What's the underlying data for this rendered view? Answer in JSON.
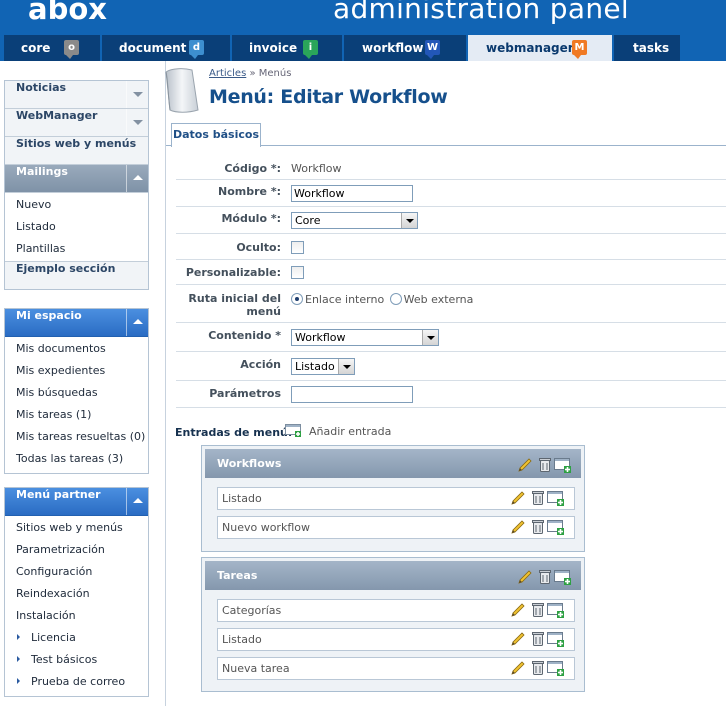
{
  "header": {
    "logo": "abox",
    "title": "administration panel"
  },
  "tabs": [
    {
      "label": "core",
      "icon": "core-icon",
      "icon_char": "o",
      "icon_color": "#8a8a8a",
      "active": false
    },
    {
      "label": "document",
      "icon": "document-icon",
      "icon_char": "d",
      "icon_color": "#3d8fd0",
      "active": false
    },
    {
      "label": "invoice",
      "icon": "invoice-icon",
      "icon_char": "i",
      "icon_color": "#2aa55a",
      "active": false
    },
    {
      "label": "workflow",
      "icon": "workflow-icon",
      "icon_char": "W",
      "icon_color": "#2257b8",
      "active": false
    },
    {
      "label": "webmanager",
      "icon": "webmanager-icon",
      "icon_char": "M",
      "icon_color": "#f07a24",
      "active": true
    },
    {
      "label": "tasks",
      "icon": "",
      "icon_char": "",
      "icon_color": "",
      "active": false
    }
  ],
  "sidebar": {
    "box1": {
      "noticias": "Noticias",
      "webmanager": "WebManager",
      "sitios": "Sitios web y menús",
      "mailings": "Mailings",
      "mailing_items": [
        "Nuevo",
        "Listado",
        "Plantillas"
      ],
      "ejemplo": "Ejemplo sección"
    },
    "mi_espacio": {
      "title": "Mi espacio",
      "items": [
        "Mis documentos",
        "Mis expedientes",
        "Mis búsquedas",
        "Mis tareas (1)",
        "Mis tareas resueltas (0)",
        "Todas las tareas (3)"
      ]
    },
    "menu_partner": {
      "title": "Menú partner",
      "items": [
        "Sitios web y menús",
        "Parametrización",
        "Configuración",
        "Reindexación",
        "Instalación"
      ],
      "sub_items": [
        "Licencia",
        "Test básicos",
        "Prueba de correo"
      ]
    }
  },
  "breadcrumb": {
    "link": "Articles",
    "sep": " » ",
    "current": "Menús"
  },
  "page_title": "Menú: Editar Workflow",
  "form_tab": "Datos básicos",
  "form": {
    "codigo_label": "Código *:",
    "codigo_value": "Workflow",
    "nombre_label": "Nombre *:",
    "nombre_value": "Workflow",
    "modulo_label": "Módulo *:",
    "modulo_value": "Core",
    "oculto_label": "Oculto:",
    "personalizable_label": "Personalizable:",
    "ruta_label_1": "Ruta inicial del",
    "ruta_label_2": "menú",
    "ruta_option_1": "Enlace interno",
    "ruta_option_2": "Web externa",
    "contenido_label": "Contenido *",
    "contenido_value": "Workflow",
    "accion_label": "Acción",
    "accion_value": "Listado",
    "parametros_label": "Parámetros",
    "parametros_value": ""
  },
  "entradas": {
    "label": "Entradas de menú:",
    "add": "Añadir entrada",
    "groups": [
      {
        "title": "Workflows",
        "items": [
          "Listado",
          "Nuevo workflow"
        ]
      },
      {
        "title": "Tareas",
        "items": [
          "Categorías",
          "Listado",
          "Nueva tarea"
        ]
      }
    ]
  }
}
